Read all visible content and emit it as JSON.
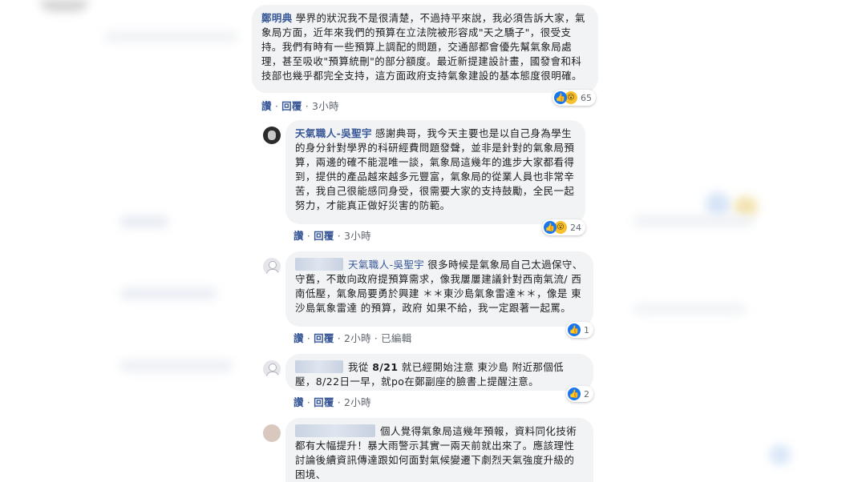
{
  "comments": [
    {
      "name": "鄭明典",
      "text": "學界的狀況我不是很清楚，不過持平來說，我必須告訴大家，氣象局方面，近年來我們的預算在立法院被形容成\"天之驕子\"，很受支持。我們有時有一些預算上調配的問題，交通部都會優先幫氣象局處理，甚至吸收\"預算統刪\"的部分額度。最近新提建設計畫，國發會和科技部也幾乎都完全支持，這方面政府支持氣象建設的基本態度很明確。",
      "like": "讚",
      "reply": "回覆",
      "time": "3小時",
      "reactions": {
        "icons": [
          "like-icon",
          "wow-icon"
        ],
        "count": "65"
      }
    },
    {
      "name": "天氣職人-吳聖宇",
      "text": "感謝典哥，我今天主要也是以自己身為學生的身分針對學界的科研經費問題發聲，並非是針對的氣象局預算，兩邊的確不能混唯一談，氣象局這幾年的進步大家都看得到，提供的產品越來越多元豐富，氣象局的從業人員也非常辛苦，我自己很能感同身受，很需要大家的支持鼓勵，全民一起努力，才能真正做好災害的防範。",
      "like": "讚",
      "reply": "回覆",
      "time": "3小時",
      "reactions": {
        "icons": [
          "like-icon",
          "wow-icon"
        ],
        "count": "24"
      }
    },
    {
      "tag": "天氣職人-吳聖宇",
      "text": "很多時候是氣象局自己太過保守、守舊，不敢向政府提預算需求，像我屢屢建議針對西南氣流/ 西南低壓，氣象局要勇於興建 ＊＊東沙島氣象雷達＊＊，像是 東沙島氣象雷達 的預算，政府 如果不給，我一定跟著一起罵。",
      "like": "讚",
      "reply": "回覆",
      "time": "2小時",
      "edited": "已編輯",
      "reactions": {
        "icons": [
          "like-icon"
        ],
        "count": "1"
      }
    },
    {
      "text_parts": [
        "我從 ",
        "8/21",
        " 就已經開始注意 東沙島 附近那個低壓，8/22日一早，就po在鄭副座的臉書上提醒注意。"
      ],
      "like": "讚",
      "reply": "回覆",
      "time": "2小時",
      "reactions": {
        "icons": [
          "like-icon"
        ],
        "count": "2"
      }
    },
    {
      "text": "個人覺得氣象局這幾年預報，資料同化技術都有大幅提升！暴大雨警示其實一兩天前就出來了。應該理性討論後續資訊傳達跟如何面對氣候變遷下劇烈天氣強度升級的困境、"
    }
  ]
}
